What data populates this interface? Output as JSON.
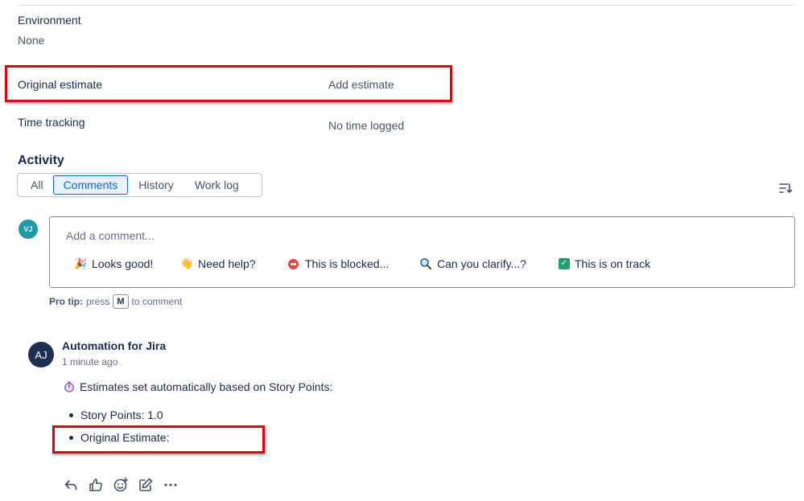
{
  "fields": {
    "environment": {
      "label": "Environment",
      "value": "None"
    },
    "original_estimate": {
      "label": "Original estimate",
      "value": "Add estimate"
    },
    "time_tracking": {
      "label": "Time tracking",
      "value": "No time logged"
    }
  },
  "activity": {
    "title": "Activity",
    "tabs": [
      {
        "label": "All"
      },
      {
        "label": "Comments"
      },
      {
        "label": "History"
      },
      {
        "label": "Work log"
      }
    ],
    "active_tab": "Comments"
  },
  "comment_editor": {
    "avatar_initials": "VJ",
    "placeholder": "Add a comment...",
    "quick_replies": [
      {
        "label": "Looks good!",
        "icon": "party-popper-icon"
      },
      {
        "label": "Need help?",
        "icon": "waving-hand-icon"
      },
      {
        "label": "This is blocked...",
        "icon": "no-entry-icon"
      },
      {
        "label": "Can you clarify...?",
        "icon": "magnifier-icon"
      },
      {
        "label": "This is on track",
        "icon": "check-mark-icon"
      }
    ],
    "pro_tip": {
      "label": "Pro tip:",
      "before": "press",
      "key": "M",
      "after": "to comment"
    }
  },
  "comment": {
    "avatar_initials": "AJ",
    "author": "Automation for Jira",
    "timestamp": "1 minute ago",
    "body_line": "Estimates set automatically based on Story Points:",
    "items": [
      "Story Points: 1.0",
      "Original Estimate:"
    ]
  },
  "colors": {
    "highlight": "#e3000f",
    "active_tab": "#0c66e4",
    "avatar_vj": "#1d9aaa",
    "avatar_aj": "#1d2f52"
  }
}
